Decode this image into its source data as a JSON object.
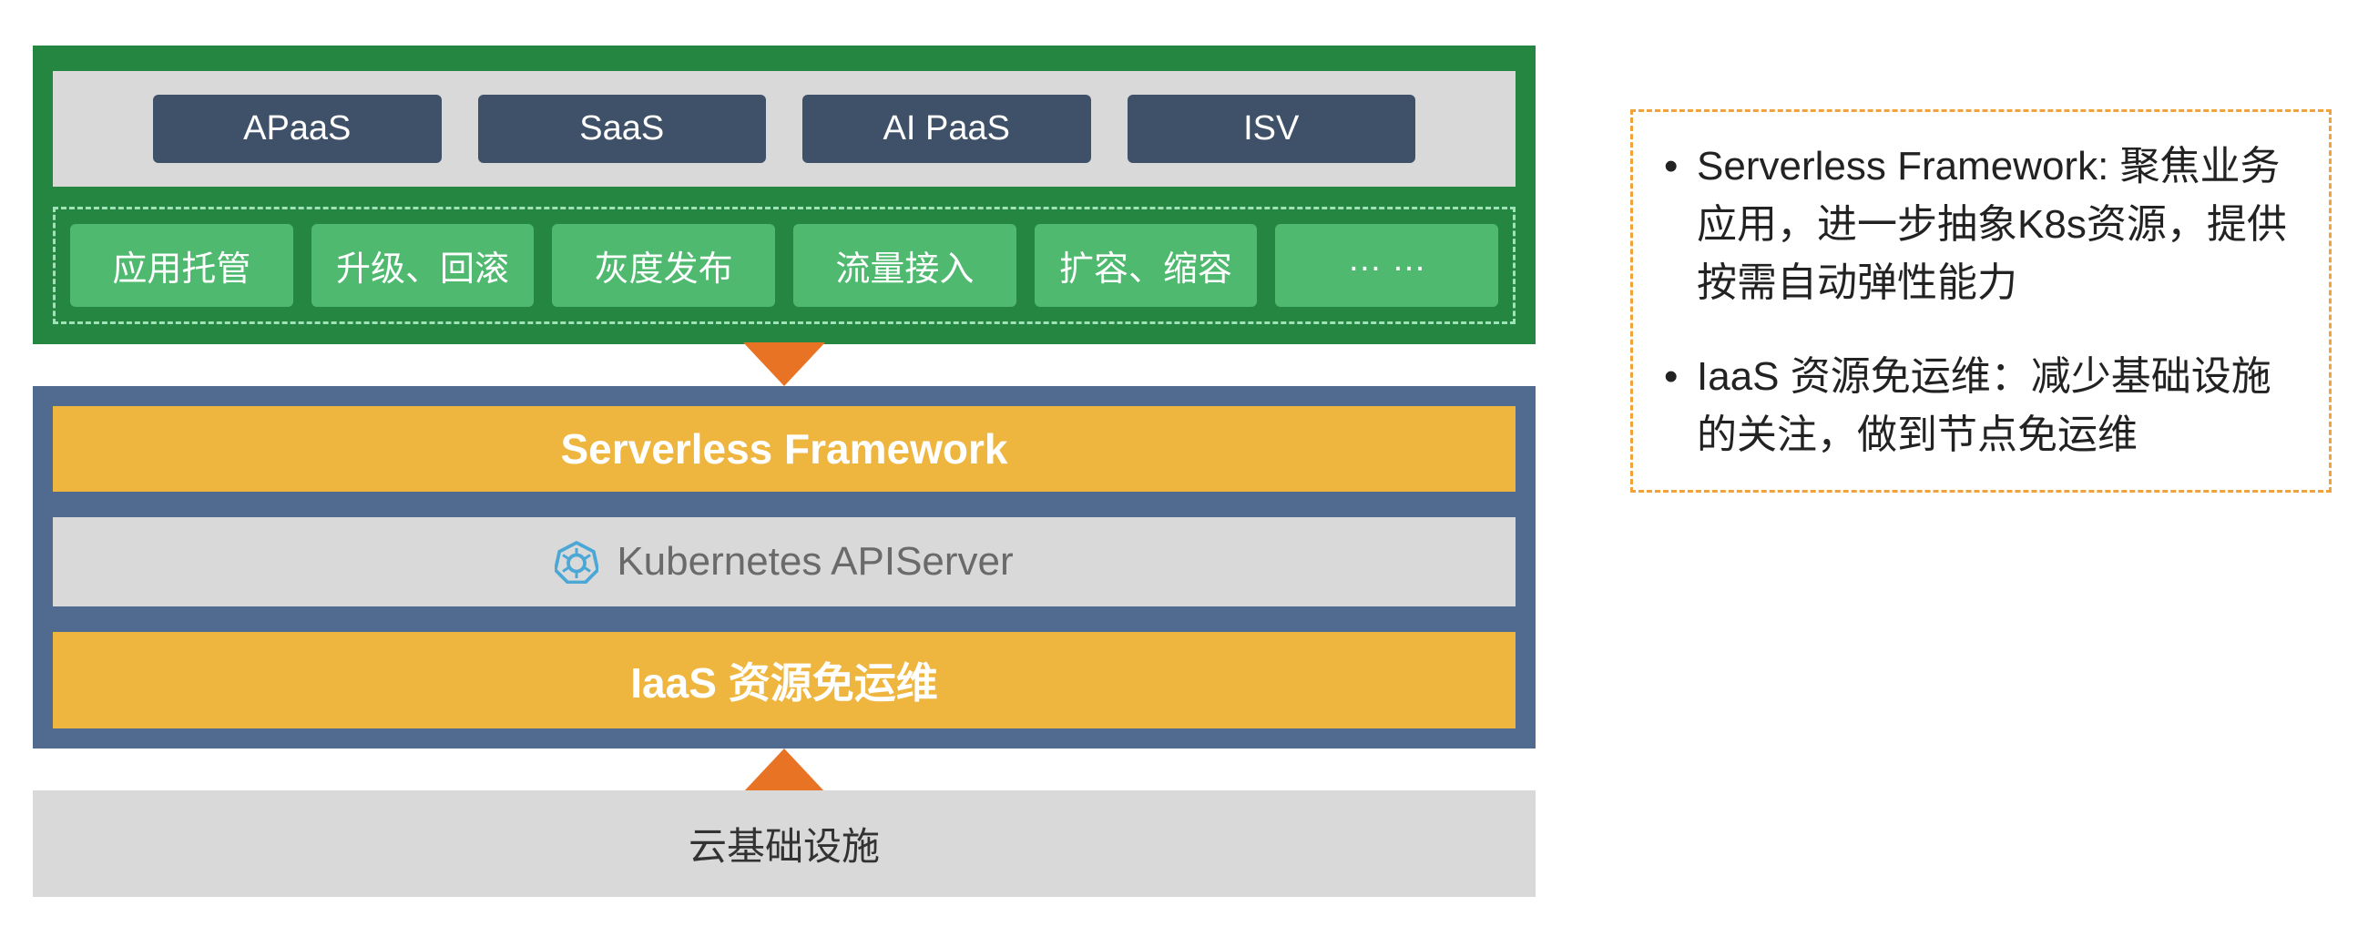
{
  "top": {
    "products": [
      "APaaS",
      "SaaS",
      "AI PaaS",
      "ISV"
    ],
    "capabilities": [
      "应用托管",
      "升级、回滚",
      "灰度发布",
      "流量接入",
      "扩容、缩容",
      "… …"
    ]
  },
  "middle": {
    "framework": "Serverless Framework",
    "api_server": "Kubernetes APIServer",
    "iaas": "IaaS 资源免运维"
  },
  "cloud_infra": "云基础设施",
  "desc": {
    "bullet1": "Serverless Framework: 聚焦业务应用，进一步抽象K8s资源，提供按需自动弹性能力",
    "bullet2": "IaaS 资源免运维：减少基础设施的关注，做到节点免运维"
  },
  "icon_name": "kubernetes-icon"
}
